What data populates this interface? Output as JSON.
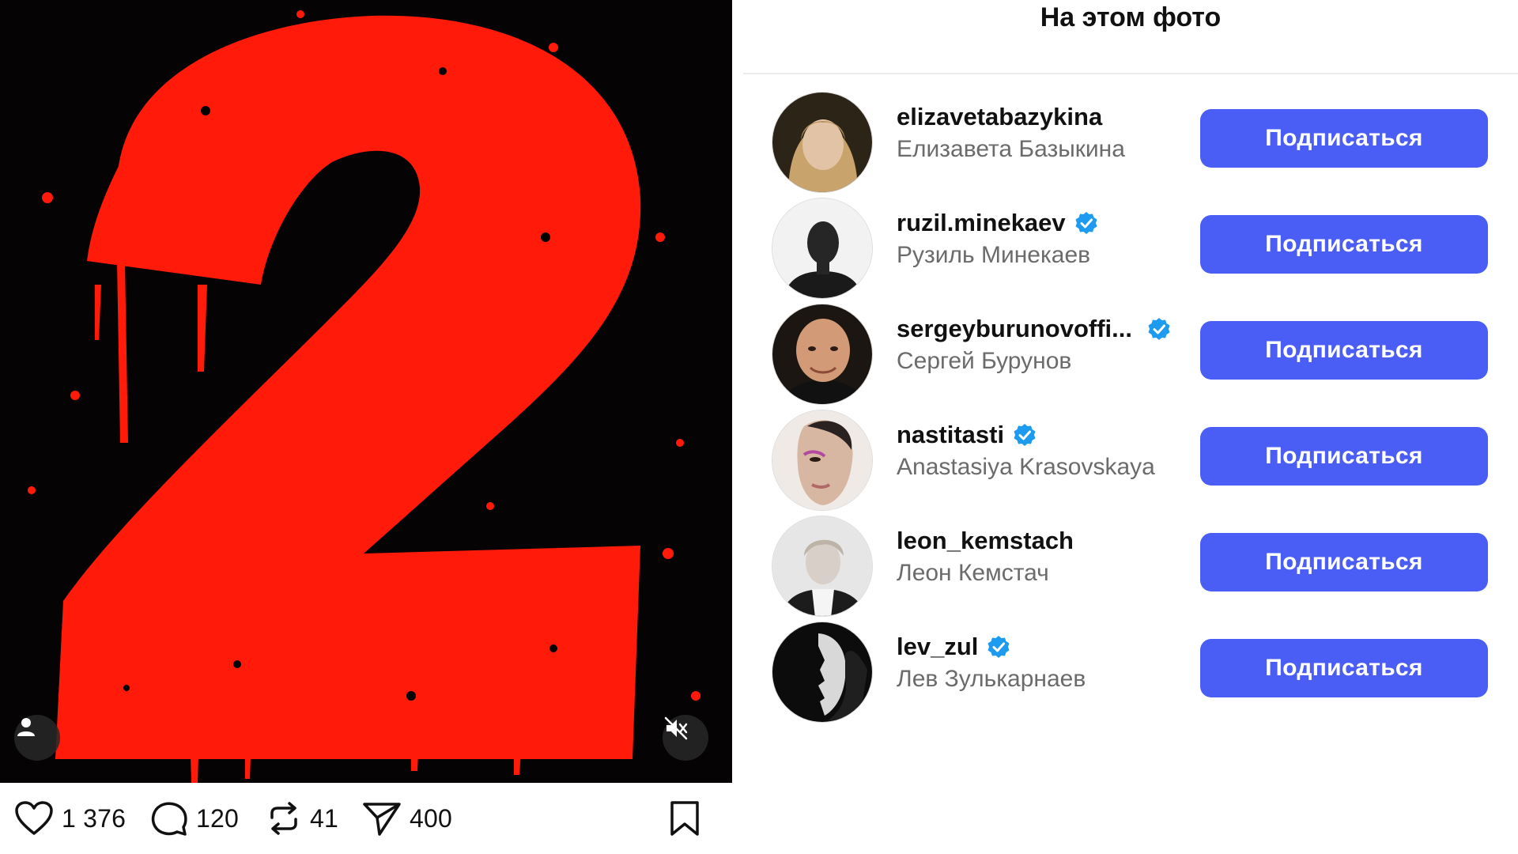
{
  "post": {
    "media": {
      "graphic": "red-blood-splatter-number-two",
      "background_color": "#050303",
      "graphic_color": "#ff1a0a",
      "tag_icon": "person-icon",
      "mute_icon": "speaker-muted-icon"
    },
    "actions": {
      "likes": "1 376",
      "comments": "120",
      "reposts": "41",
      "shares": "400",
      "icons": [
        "heart-icon",
        "comment-icon",
        "repost-icon",
        "share-icon",
        "bookmark-icon"
      ]
    }
  },
  "tagged_panel": {
    "title": "На этом фото",
    "follow_button_color": "#4a5df5",
    "verified_color": "#1d9bf0",
    "people": [
      {
        "username": "elizavetabazykina",
        "full_name": "Елизавета Базыкина",
        "verified": false,
        "button": "Подписаться"
      },
      {
        "username": "ruzil.minekaev",
        "full_name": "Рузиль Минекаев",
        "verified": true,
        "button": "Подписаться"
      },
      {
        "username": "sergeyburunovoffi...",
        "full_name": "Сергей Бурунов",
        "verified": true,
        "button": "Подписаться"
      },
      {
        "username": "nastitasti",
        "full_name": "Anastasiya Krasovskaya",
        "verified": true,
        "button": "Подписаться"
      },
      {
        "username": "leon_kemstach",
        "full_name": "Леон Кемстач",
        "verified": false,
        "button": "Подписаться"
      },
      {
        "username": "lev_zul",
        "full_name": "Лев Зулькарнаев",
        "verified": true,
        "button": "Подписаться"
      }
    ]
  }
}
